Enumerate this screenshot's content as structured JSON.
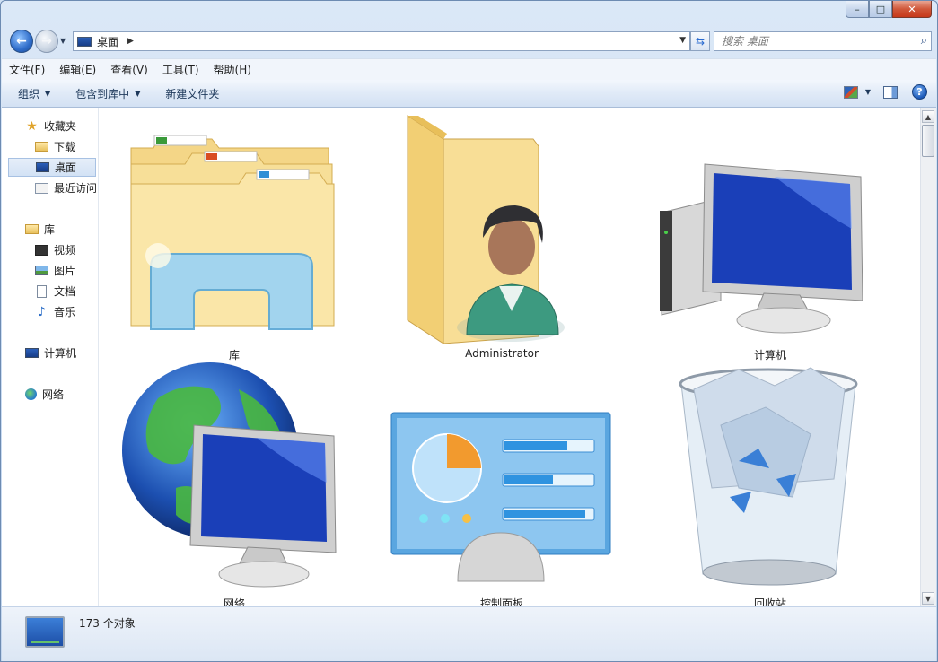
{
  "window": {
    "caption_buttons": {
      "minimize": "–",
      "maximize": "□",
      "close": "✕"
    }
  },
  "address_bar": {
    "location": "桌面",
    "chevron": "▶",
    "dropdown": "▼"
  },
  "search": {
    "placeholder": "搜索 桌面",
    "icon": "search-icon"
  },
  "menu": [
    "文件(F)",
    "编辑(E)",
    "查看(V)",
    "工具(T)",
    "帮助(H)"
  ],
  "commands": [
    {
      "label": "组织",
      "has_caret": true
    },
    {
      "label": "包含到库中",
      "has_caret": true
    },
    {
      "label": "新建文件夹",
      "has_caret": false
    }
  ],
  "nav_pane": {
    "favorites": {
      "label": "收藏夹",
      "items": [
        "下载",
        "桌面",
        "最近访问"
      ],
      "selected": "桌面"
    },
    "libraries": {
      "label": "库",
      "items": [
        "视频",
        "图片",
        "文档",
        "音乐"
      ]
    },
    "computer": {
      "label": "计算机"
    },
    "network": {
      "label": "网络"
    }
  },
  "items": [
    {
      "name": "库",
      "icon": "libraries-folder-icon"
    },
    {
      "name": "Administrator",
      "icon": "user-folder-icon"
    },
    {
      "name": "计算机",
      "icon": "computer-icon"
    },
    {
      "name": "网络",
      "icon": "network-globe-icon"
    },
    {
      "name": "控制面板",
      "icon": "control-panel-icon"
    },
    {
      "name": "回收站",
      "icon": "recycle-bin-icon"
    }
  ],
  "status": {
    "count_text": "173 个对象"
  },
  "colors": {
    "accent": "#2a6bd0",
    "frame": "#cadcf2",
    "close": "#c7391a"
  }
}
